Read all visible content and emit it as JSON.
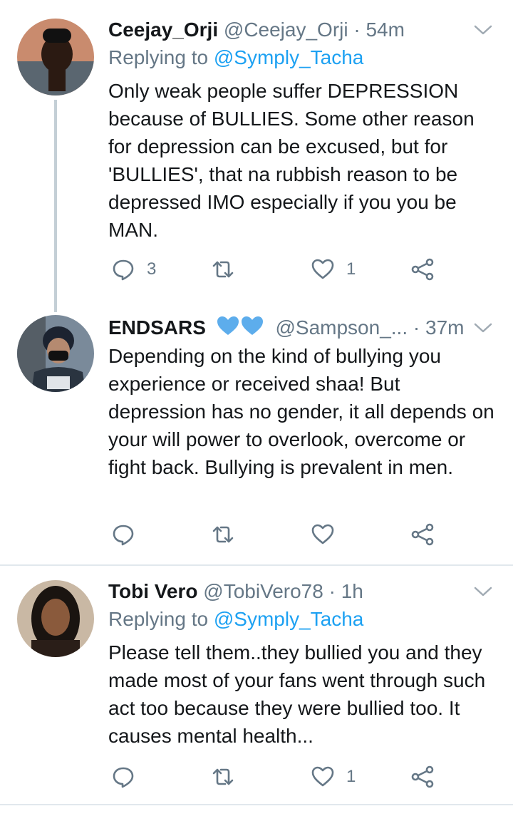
{
  "tweets": [
    {
      "name": "Ceejay_Orji",
      "handle": "@Ceejay_Orji",
      "dot": "·",
      "time": "54m",
      "replying_prefix": "Replying to",
      "replying_to": "@Symply_Tacha",
      "text": "Only weak people suffer DEPRESSION because of BULLIES. Some other reason for depression can be excused, but for 'BULLIES', that na rubbish reason to be depressed IMO especially if you you be MAN.",
      "reply_count": "3",
      "retweet_count": "",
      "like_count": "1"
    },
    {
      "name": "ENDSARS",
      "name_emoji": [
        "blue-heart",
        "blue-heart"
      ],
      "handle": "@Sampson_...",
      "dot": "·",
      "time": "37m",
      "text": "Depending on the kind of bullying you experience or received shaa! But depression has no gender, it all depends on your will power to overlook, overcome or fight back. Bullying is prevalent in men.",
      "reply_count": "",
      "retweet_count": "",
      "like_count": ""
    },
    {
      "name": "Tobi Vero",
      "handle": "@TobiVero78",
      "dot": "·",
      "time": "1h",
      "replying_prefix": "Replying to",
      "replying_to": "@Symply_Tacha",
      "text": "Please tell them..they bullied you and they made most of your fans went through such act too because they were bullied too. It causes mental health...",
      "reply_count": "",
      "retweet_count": "",
      "like_count": "1"
    }
  ],
  "icons": {
    "reply": "reply-icon",
    "retweet": "retweet-icon",
    "like": "heart-icon",
    "share": "share-icon",
    "menu": "chevron-down-icon"
  },
  "colors": {
    "link": "#1da1f2",
    "muted": "#657786",
    "text": "#14171a",
    "divider": "#e1e8ed",
    "thread_line": "#c4cfd6",
    "heart_emoji": "#5dadec"
  }
}
